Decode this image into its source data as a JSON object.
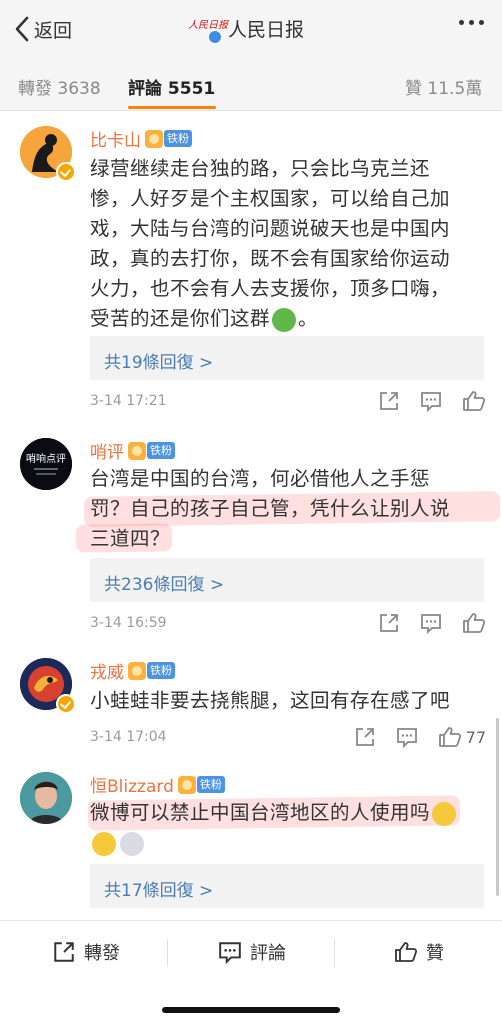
{
  "nav": {
    "back_label": "返回",
    "title": "人民日报",
    "logo_text": "人民日报"
  },
  "tabs": {
    "repost_label": "轉發",
    "repost_count": "3638",
    "comment_label": "評論",
    "comment_count": "5551",
    "like_label": "贊",
    "like_count": "11.5萬"
  },
  "comments": [
    {
      "name": "比卡山",
      "fan_tag": "铁粉",
      "text_lines": [
        "绿营继续走台独的路，只会比乌克兰还",
        "惨，人好歹是个主权国家，可以给自己加",
        "戏，大陆与台湾的问题说破天也是中国内",
        "政，真的去打你，既不会有国家给你运动",
        "火力，也不会有人去支援你，顶多口嗨，",
        "受苦的还是你们这群"
      ],
      "text_tail": "。",
      "reply_text": "共19條回復 >",
      "time": "3-14 17:21",
      "likes": ""
    },
    {
      "name": "哨评",
      "fan_tag": "铁粉",
      "avatar_text": "哨响点评",
      "text_lines": [
        "台湾是中国的台湾，何必借他人之手惩",
        "罚？自己的孩子自己管，凭什么让别人说",
        "三道四？"
      ],
      "reply_text": "共236條回復 >",
      "time": "3-14 16:59",
      "likes": ""
    },
    {
      "name": "戎威",
      "fan_tag": "铁粉",
      "text_lines": [
        "小蛙蛙非要去挠熊腿，这回有存在感了吧"
      ],
      "time": "3-14 17:04",
      "likes": "77"
    },
    {
      "name": "恒Blizzard",
      "fan_tag": "铁粉",
      "text_lines": [
        "微博可以禁止中国台湾地区的人使用吗"
      ],
      "reply_text": "共17條回復 >"
    }
  ],
  "bottom_bar": {
    "repost": "轉發",
    "comment": "評論",
    "like": "贊"
  },
  "colors": {
    "accent": "#ff8200",
    "name": "#eb7340",
    "link": "#4a7db3"
  }
}
